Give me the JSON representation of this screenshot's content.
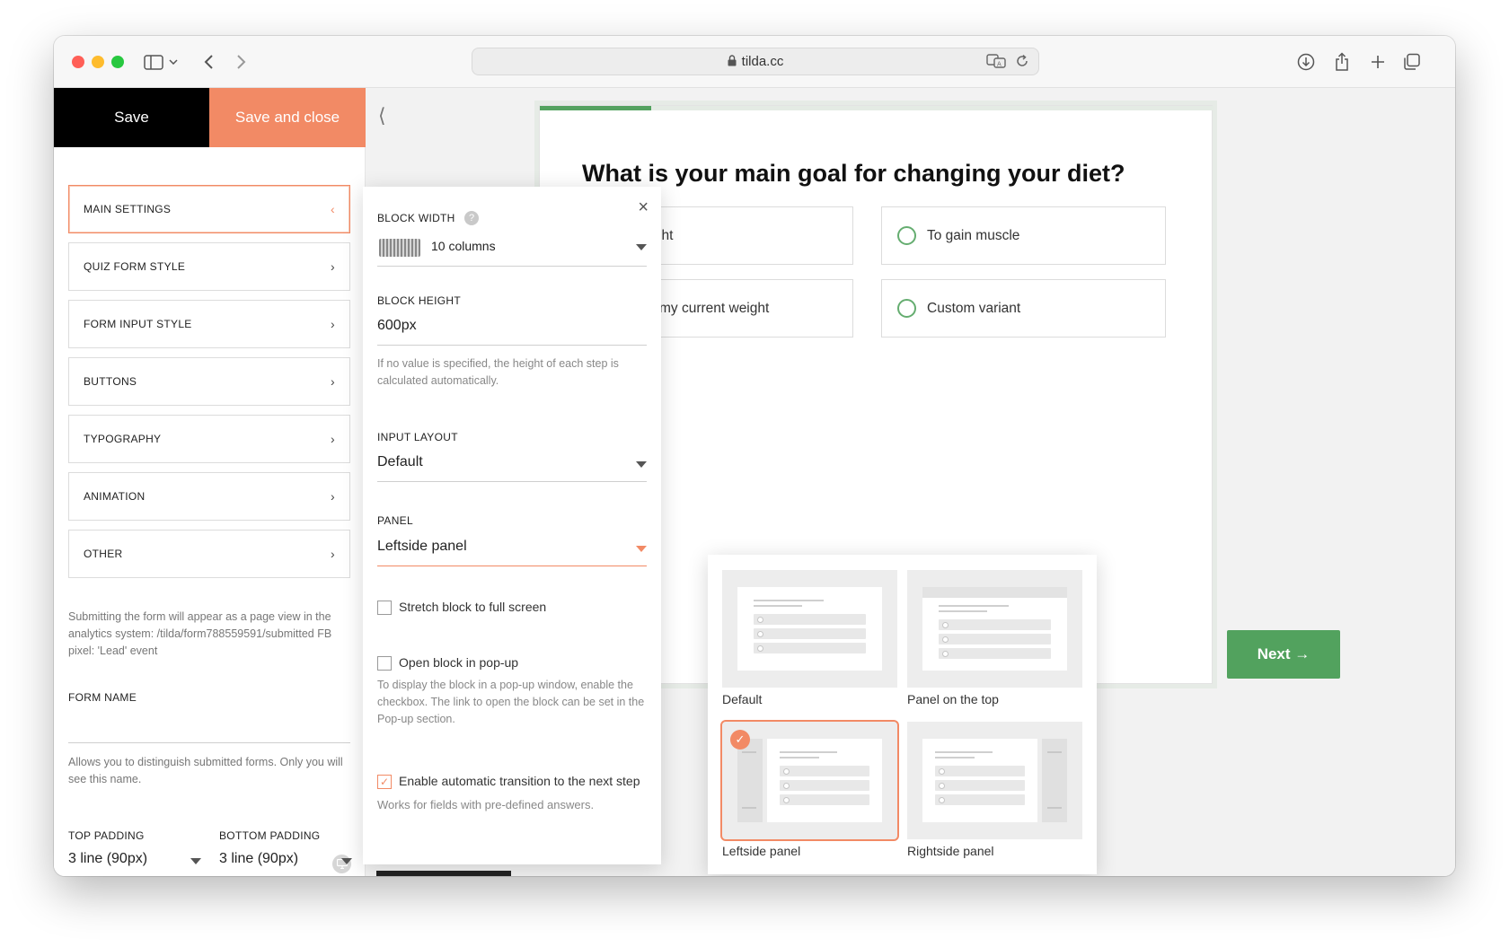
{
  "browser": {
    "url": "tilda.cc",
    "traffic_colors": [
      "#ff5f57",
      "#febc2e",
      "#28c840"
    ]
  },
  "sidebar": {
    "save_label": "Save",
    "save_close_label": "Save and close",
    "items": [
      {
        "label": "MAIN SETTINGS",
        "active": true
      },
      {
        "label": "QUIZ FORM STYLE",
        "active": false
      },
      {
        "label": "FORM INPUT STYLE",
        "active": false
      },
      {
        "label": "BUTTONS",
        "active": false
      },
      {
        "label": "TYPOGRAPHY",
        "active": false
      },
      {
        "label": "ANIMATION",
        "active": false
      },
      {
        "label": "OTHER",
        "active": false
      }
    ],
    "analytics_note": "Submitting the form will appear as a page view in the analytics system: /tilda/form788559591/submitted FB pixel: 'Lead' event",
    "form_name_label": "FORM NAME",
    "form_name_value": "",
    "form_name_note": "Allows you to distinguish submitted forms. Only you will see this name.",
    "top_padding_label": "TOP PADDING",
    "top_padding_value": "3 line (90px)",
    "bottom_padding_label": "BOTTOM PADDING",
    "bottom_padding_value": "3 line (90px)"
  },
  "quiz": {
    "progress": 0.165,
    "question": "What is your main goal for changing your diet?",
    "options": [
      "se weight",
      "To gain muscle",
      "aintain my current weight",
      "Custom variant"
    ],
    "next_label": "Next →"
  },
  "settings": {
    "block_width_label": "BLOCK WIDTH",
    "block_width_value": "10 columns",
    "block_height_label": "BLOCK HEIGHT",
    "block_height_value": "600px",
    "block_height_note": "If no value is specified, the height of each step is calculated automatically.",
    "input_layout_label": "INPUT LAYOUT",
    "input_layout_value": "Default",
    "panel_label": "PANEL",
    "panel_value": "Leftside panel",
    "stretch_label": "Stretch block to full screen",
    "stretch_checked": false,
    "popup_label": "Open block in pop-up",
    "popup_checked": false,
    "popup_note": "To display the block in a pop-up window, enable the checkbox. The link to open the block can be set in the Pop-up section.",
    "auto_label": "Enable automatic transition to the next step",
    "auto_checked": true,
    "auto_note": "Works for fields with pre-defined answers."
  },
  "panel_options": [
    {
      "label": "Default",
      "selected": false
    },
    {
      "label": "Panel on the top",
      "selected": false
    },
    {
      "label": "Leftside panel",
      "selected": true
    },
    {
      "label": "Rightside panel",
      "selected": false
    }
  ],
  "colors": {
    "accent": "#f28a65",
    "green": "#52a25e",
    "black": "#000000"
  }
}
